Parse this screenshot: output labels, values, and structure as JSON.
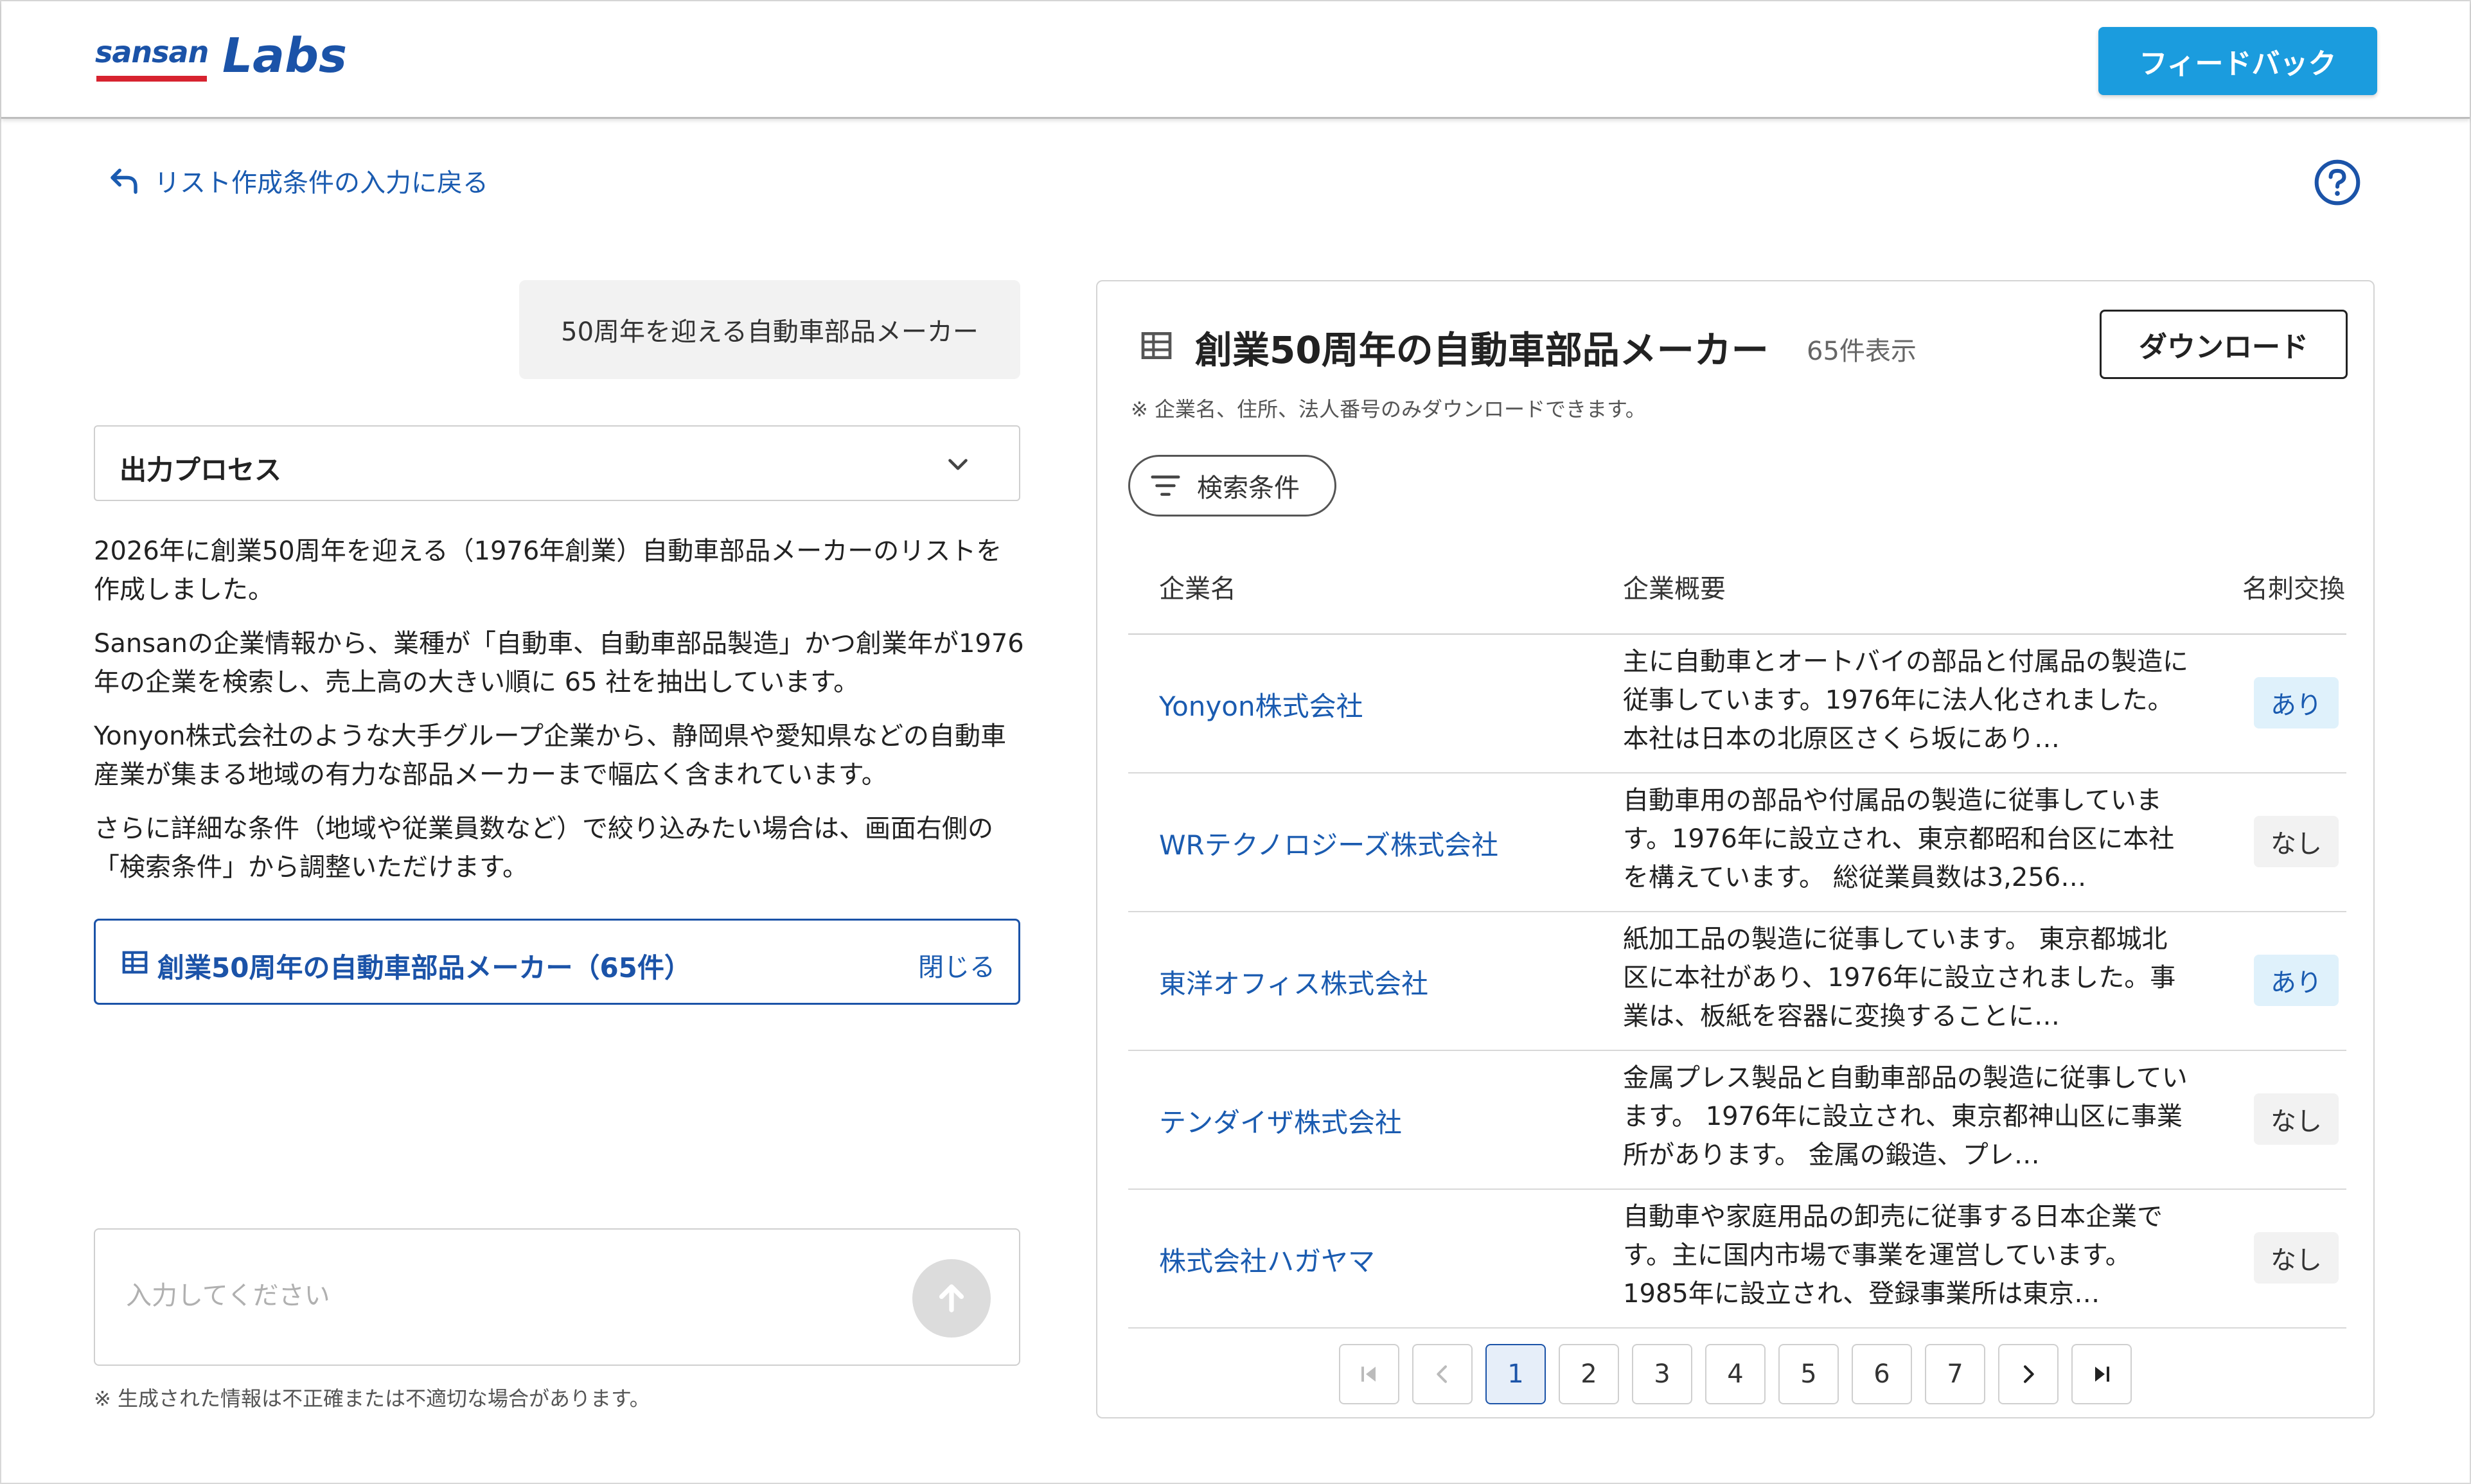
{
  "header": {
    "logo_brand": "sansan",
    "logo_product": "Labs",
    "feedback_label": "フィードバック"
  },
  "nav": {
    "back_label": "リスト作成条件の入力に戻る"
  },
  "chat": {
    "query": "50周年を迎える自動車部品メーカー",
    "process_title": "出力プロセス",
    "paragraphs": [
      "2026年に創業50周年を迎える（1976年創業）自動車部品メーカーのリストを作成しました。",
      "Sansanの企業情報から、業種が「自動車、自動車部品製造」かつ創業年が1976年の企業を検索し、売上高の大きい順に 65 社を抽出しています。",
      "Yonyon株式会社のような大手グループ企業から、静岡県や愛知県などの自動車産業が集まる地域の有力な部品メーカーまで幅広く含まれています。",
      "さらに詳細な条件（地域や従業員数など）で絞り込みたい場合は、画面右側の「検索条件」から調整いただけます。"
    ],
    "result_link_label": "創業50周年の自動車部品メーカー（65件）",
    "result_link_close": "閉じる",
    "input_placeholder": "入力してください",
    "disclaimer": "※ 生成された情報は不正確または不適切な場合があります。"
  },
  "panel": {
    "title": "創業50周年の自動車部品メーカー",
    "count": "65件表示",
    "download_label": "ダウンロード",
    "note": "※ 企業名、住所、法人番号のみダウンロードできます。",
    "filter_label": "検索条件",
    "columns": [
      "企業名",
      "企業概要",
      "名刺交換"
    ],
    "rows": [
      {
        "name": "Yonyon株式会社",
        "desc": "主に自動車とオートバイの部品と付属品の製造に従事しています。1976年に法人化されました。本社は日本の北原区さくら坂にあり…",
        "card": "あり"
      },
      {
        "name": "WRテクノロジーズ株式会社",
        "desc": "自動車用の部品や付属品の製造に従事しています。1976年に設立され、東京都昭和台区に本社を構えています。 総従業員数は3,256…",
        "card": "なし"
      },
      {
        "name": "東洋オフィス株式会社",
        "desc": "紙加工品の製造に従事しています。 東京都城北区に本社があり、1976年に設立されました。事業は、板紙を容器に変換することに…",
        "card": "あり"
      },
      {
        "name": "テンダイザ株式会社",
        "desc": "金属プレス製品と自動車部品の製造に従事しています。 1976年に設立され、東京都神山区に事業所があります。 金属の鍛造、プレ…",
        "card": "なし"
      },
      {
        "name": "株式会社ハガヤマ",
        "desc": "自動車や家庭用品の卸売に従事する日本企業です。主に国内市場で事業を運営しています。1985年に設立され、登録事業所は東京…",
        "card": "なし"
      }
    ],
    "pagination": {
      "pages": [
        "1",
        "2",
        "3",
        "4",
        "5",
        "6",
        "7"
      ],
      "current": "1"
    }
  },
  "colors": {
    "brand": "#1b53a8",
    "accent": "#1b9cde",
    "logo_red": "#d7232f"
  }
}
